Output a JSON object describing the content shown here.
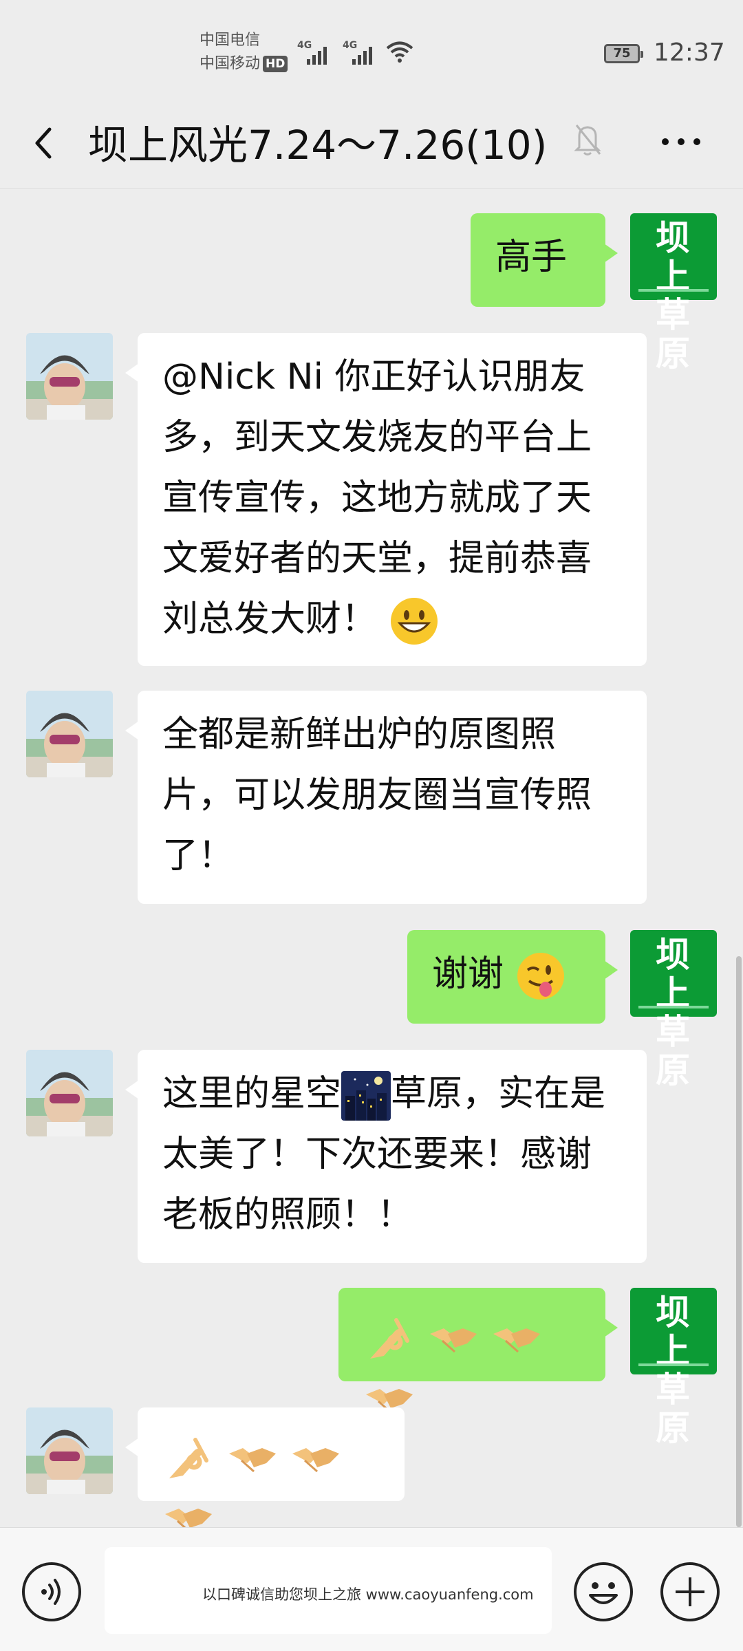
{
  "status_bar": {
    "carrier_1": "中国电信",
    "carrier_2": "中国移动",
    "hd_badge": "HD",
    "network_1": "4G",
    "network_2": "4G",
    "battery_level": "75",
    "time": "12:37"
  },
  "header": {
    "title": "坝上风光7.24～7.26(10)",
    "muted": true
  },
  "self_avatar_text": "坝上草原",
  "messages": [
    {
      "sender": "self",
      "text": "高手"
    },
    {
      "sender": "other",
      "text": "@Nick Ni 你正好认识朋友多，到天文发烧友的平台上宣传宣传，这地方就成了天文爱好者的天堂，提前恭喜刘总发大财！",
      "emoji": "grinning-face"
    },
    {
      "sender": "other",
      "text": "全都是新鲜出炉的原图照片，可以发朋友圈当宣传照了！"
    },
    {
      "sender": "self",
      "text": "谢谢",
      "emoji": "winking-face-with-tongue"
    },
    {
      "sender": "other",
      "text_part_1": "这里的星空",
      "emoji": "night-city",
      "text_part_2": "草原，实在是太美了！下次还要来！感谢老板的照顾！！"
    },
    {
      "sender": "self",
      "emoji_sequence": [
        "ok-hand",
        "handshake",
        "handshake",
        "handshake"
      ]
    },
    {
      "sender": "other",
      "emoji_sequence": [
        "ok-hand",
        "handshake",
        "handshake",
        "handshake"
      ]
    }
  ],
  "input_bar": {
    "watermark": "以口碑诚信助您坝上之旅 www.caoyuanfeng.com"
  },
  "colors": {
    "self_bubble": "#95ec69",
    "other_bubble": "#ffffff",
    "background": "#ededed",
    "self_avatar": "#0c9b35"
  }
}
